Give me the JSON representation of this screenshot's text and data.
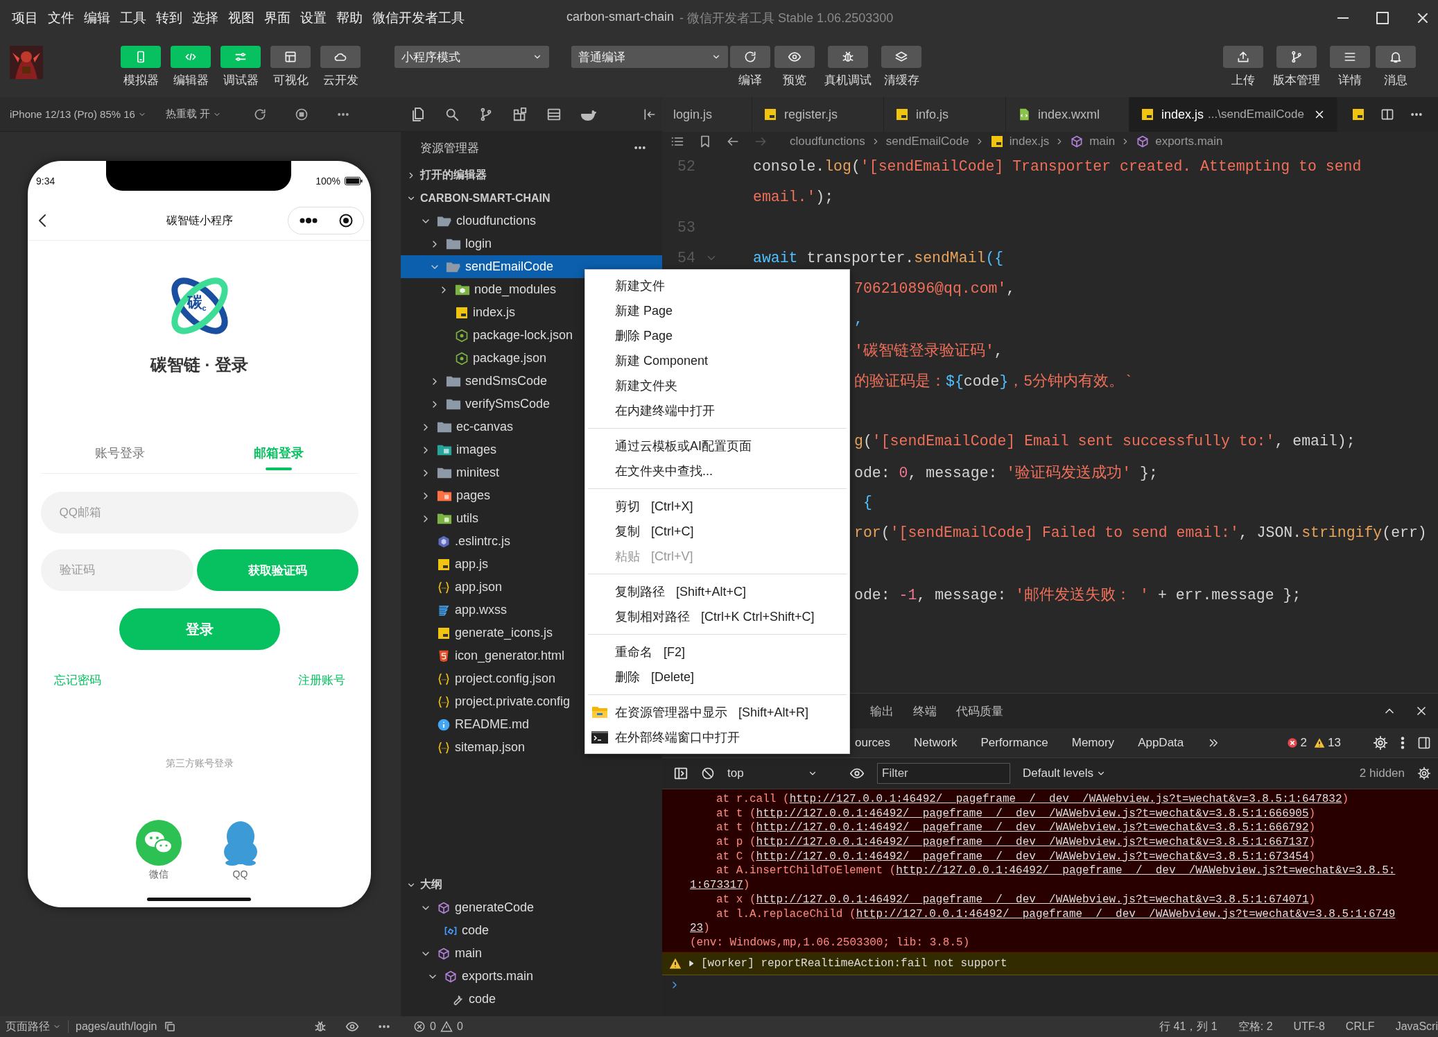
{
  "menubar": {
    "items": [
      "项目",
      "文件",
      "编辑",
      "工具",
      "转到",
      "选择",
      "视图",
      "界面",
      "设置",
      "帮助",
      "微信开发者工具"
    ],
    "title": "carbon-smart-chain",
    "subtitle": "- 微信开发者工具 Stable 1.06.2503300"
  },
  "toolbar": {
    "view_buttons": [
      {
        "label": "模拟器",
        "selected": true
      },
      {
        "label": "编辑器",
        "selected": true
      },
      {
        "label": "调试器",
        "selected": true
      },
      {
        "label": "可视化",
        "selected": false
      },
      {
        "label": "云开发",
        "selected": false
      }
    ],
    "mode_select": "小程序模式",
    "compile_select": "普通编译",
    "actions": [
      "编译",
      "预览",
      "真机调试",
      "清缓存"
    ],
    "right_actions": [
      "上传",
      "版本管理",
      "详情",
      "消息"
    ]
  },
  "simulator": {
    "device": "iPhone 12/13 (Pro) 85% 16",
    "hot_reload": "热重载 开",
    "phone": {
      "time": "9:34",
      "battery": "100%",
      "nav_title": "碳智链小程序",
      "logo_text": "碳$_{c}$",
      "app_title": "碳智链 · 登录",
      "tabs": [
        {
          "label": "账号登录",
          "selected": false
        },
        {
          "label": "邮箱登录",
          "selected": true
        }
      ],
      "email_placeholder": "QQ邮箱",
      "code_placeholder": "验证码",
      "get_code_button": "获取验证码",
      "login_button": "登录",
      "forgot_link": "忘记密码",
      "register_link": "注册账号",
      "third_party_label": "第三方账号登录",
      "social": [
        {
          "label": "微信",
          "kind": "wechat"
        },
        {
          "label": "QQ",
          "kind": "qq"
        }
      ]
    },
    "page_path_label": "页面路径",
    "page_path": "pages/auth/login"
  },
  "explorer": {
    "title": "资源管理器",
    "open_editors": "打开的编辑器",
    "project": "CARBON-SMART-CHAIN",
    "tree": [
      {
        "label": "cloudfunctions",
        "kind": "folder",
        "expanded": true,
        "selected": false,
        "children": [
          {
            "label": "login",
            "kind": "folder",
            "expanded": false,
            "selected": false
          },
          {
            "label": "sendEmailCode",
            "kind": "folder",
            "expanded": true,
            "selected": true,
            "children": [
              {
                "label": "node_modules",
                "kind": "node-folder",
                "expanded": false,
                "selected": false
              },
              {
                "label": "index.js",
                "kind": "js",
                "selected": false
              },
              {
                "label": "package-lock.json",
                "kind": "npm",
                "selected": false
              },
              {
                "label": "package.json",
                "kind": "npm",
                "selected": false
              }
            ]
          },
          {
            "label": "sendSmsCode",
            "kind": "folder",
            "expanded": false,
            "selected": false
          },
          {
            "label": "verifySmsCode",
            "kind": "folder",
            "expanded": false,
            "selected": false
          }
        ]
      },
      {
        "label": "ec-canvas",
        "kind": "folder",
        "expanded": false,
        "selected": false
      },
      {
        "label": "images",
        "kind": "image-folder",
        "expanded": false,
        "selected": false
      },
      {
        "label": "minitest",
        "kind": "folder",
        "expanded": false,
        "selected": false
      },
      {
        "label": "pages",
        "kind": "pages-folder",
        "expanded": false,
        "selected": false
      },
      {
        "label": "utils",
        "kind": "utils-folder",
        "expanded": false,
        "selected": false
      },
      {
        "label": ".eslintrc.js",
        "kind": "eslint",
        "selected": false
      },
      {
        "label": "app.js",
        "kind": "js",
        "selected": false
      },
      {
        "label": "app.json",
        "kind": "json",
        "selected": false
      },
      {
        "label": "app.wxss",
        "kind": "css",
        "selected": false
      },
      {
        "label": "generate_icons.js",
        "kind": "js",
        "selected": false
      },
      {
        "label": "icon_generator.html",
        "kind": "html",
        "selected": false
      },
      {
        "label": "project.config.json",
        "kind": "json",
        "selected": false
      },
      {
        "label": "project.private.config",
        "kind": "json",
        "selected": false
      },
      {
        "label": "README.md",
        "kind": "info",
        "selected": false
      },
      {
        "label": "sitemap.json",
        "kind": "json",
        "selected": false
      }
    ],
    "outline_title": "大纲",
    "outline": [
      {
        "label": "generateCode",
        "kind": "function",
        "expanded": true,
        "children": [
          {
            "label": "code",
            "kind": "variable"
          }
        ]
      },
      {
        "label": "main",
        "kind": "function",
        "expanded": true,
        "children": [
          {
            "label": "exports.main",
            "kind": "function",
            "expanded": true,
            "children": [
              {
                "label": "code",
                "kind": "property"
              }
            ]
          }
        ]
      }
    ],
    "problems": {
      "errors": "0",
      "warnings": "0"
    }
  },
  "editor": {
    "tabs": [
      {
        "label": "login.js",
        "kind": "none",
        "selected": false
      },
      {
        "label": "register.js",
        "kind": "js",
        "selected": false
      },
      {
        "label": "info.js",
        "kind": "js",
        "selected": false
      },
      {
        "label": "index.wxml",
        "kind": "wxml",
        "selected": false
      },
      {
        "label": "index.js",
        "description": "...\\sendEmailCode",
        "kind": "js",
        "selected": true
      }
    ],
    "breadcrumb": [
      {
        "label": "cloudfunctions",
        "kind": "folder"
      },
      {
        "label": "sendEmailCode",
        "kind": "folder"
      },
      {
        "label": "index.js",
        "kind": "js"
      },
      {
        "label": "main",
        "kind": "symbol"
      },
      {
        "label": "exports.main",
        "kind": "symbol"
      }
    ],
    "lines": [
      {
        "number": "52",
        "kind": "full",
        "segments": [
          {
            "t": "console.",
            "kind": "plain"
          },
          {
            "t": "log",
            "kind": "fn"
          },
          {
            "t": "(",
            "kind": "plain"
          },
          {
            "t": "'[sendEmailCode] Transporter created. Attempting to send",
            "kind": "str"
          }
        ]
      },
      {
        "kind": "full",
        "segments": [
          {
            "t": "email.'",
            "kind": "str"
          },
          {
            "t": ");",
            "kind": "plain"
          }
        ]
      },
      {
        "number": "53",
        "kind": "full"
      },
      {
        "number": "54",
        "kind": "full",
        "segments": [
          {
            "t": "await",
            "kind": "kw"
          },
          {
            "t": " transporter.",
            "kind": "plain"
          },
          {
            "t": "sendMail",
            "kind": "fn"
          },
          {
            "t": "({",
            "kind": "punc"
          }
        ]
      },
      {
        "kind": "after_menu",
        "segments": [
          {
            "t": "706210896@qq.com'",
            "kind": "str"
          },
          {
            "t": ",",
            "kind": "plain"
          }
        ]
      },
      {
        "kind": "after_menu",
        "segments": [
          {
            "t": ",",
            "kind": "punc"
          }
        ]
      },
      {
        "kind": "after_menu",
        "segments": [
          {
            "t": "'碳智链登录验证码'",
            "kind": "str"
          },
          {
            "t": ",",
            "kind": "plain"
          }
        ]
      },
      {
        "kind": "after_menu",
        "segments": [
          {
            "t": "的验证码是：",
            "kind": "str"
          },
          {
            "t": "${",
            "kind": "punc"
          },
          {
            "t": "code",
            "kind": "plain"
          },
          {
            "t": "}",
            "kind": "punc"
          },
          {
            "t": "，5分钟内有效。`",
            "kind": "str"
          }
        ]
      },
      {
        "kind": "after_menu"
      },
      {
        "kind": "after_menu",
        "segments": [
          {
            "t": "g",
            "kind": "fn"
          },
          {
            "t": "(",
            "kind": "plain"
          },
          {
            "t": "'[sendEmailCode] Email sent successfully to:'",
            "kind": "str"
          },
          {
            "t": ", email);",
            "kind": "plain"
          }
        ]
      },
      {
        "kind": "after_menu",
        "segments": [
          {
            "t": "ode: ",
            "kind": "plain"
          },
          {
            "t": "0",
            "kind": "num"
          },
          {
            "t": ", message: ",
            "kind": "plain"
          },
          {
            "t": "'验证码发送成功'",
            "kind": "str"
          },
          {
            "t": " };",
            "kind": "plain"
          }
        ]
      },
      {
        "kind": "after_menu",
        "segments": [
          {
            "t": " {",
            "kind": "punc"
          }
        ]
      },
      {
        "kind": "after_menu",
        "segments": [
          {
            "t": "ror",
            "kind": "fn"
          },
          {
            "t": "(",
            "kind": "plain"
          },
          {
            "t": "'[sendEmailCode] Failed to send email:'",
            "kind": "str"
          },
          {
            "t": ", JSON.",
            "kind": "plain"
          },
          {
            "t": "stringify",
            "kind": "fn"
          },
          {
            "t": "(err)",
            "kind": "plain"
          }
        ]
      },
      {
        "kind": "after_menu"
      },
      {
        "kind": "after_menu",
        "segments": [
          {
            "t": "ode: ",
            "kind": "plain"
          },
          {
            "t": "-1",
            "kind": "num"
          },
          {
            "t": ", message: ",
            "kind": "plain"
          },
          {
            "t": "'邮件发送失败： '",
            "kind": "str"
          },
          {
            "t": " + err.message };",
            "kind": "plain"
          }
        ]
      }
    ]
  },
  "context_menu": {
    "groups": [
      [
        {
          "label": "新建文件",
          "disabled": false
        },
        {
          "label": "新建 Page",
          "disabled": false
        },
        {
          "label": "删除 Page",
          "disabled": false
        },
        {
          "label": "新建 Component",
          "disabled": false
        },
        {
          "label": "新建文件夹",
          "disabled": false
        },
        {
          "label": "在内建终端中打开",
          "disabled": false
        }
      ],
      [
        {
          "label": "通过云模板或AI配置页面",
          "disabled": false
        },
        {
          "label": "在文件夹中查找...",
          "disabled": false
        }
      ],
      [
        {
          "label": "剪切",
          "shortcut": "[Ctrl+X]",
          "disabled": false
        },
        {
          "label": "复制",
          "shortcut": "[Ctrl+C]",
          "disabled": false
        },
        {
          "label": "粘贴",
          "shortcut": "[Ctrl+V]",
          "disabled": true
        }
      ],
      [
        {
          "label": "复制路径",
          "shortcut": "[Shift+Alt+C]",
          "disabled": false
        },
        {
          "label": "复制相对路径",
          "shortcut": "[Ctrl+K Ctrl+Shift+C]",
          "disabled": false
        }
      ],
      [
        {
          "label": "重命名",
          "shortcut": "[F2]",
          "disabled": false
        },
        {
          "label": "删除",
          "shortcut": "[Delete]",
          "disabled": false
        }
      ],
      [
        {
          "label": "在资源管理器中显示",
          "shortcut": "[Shift+Alt+R]",
          "disabled": false,
          "kind": "folder"
        },
        {
          "label": "在外部终端窗口中打开",
          "disabled": false,
          "kind": "terminal"
        }
      ]
    ]
  },
  "panel": {
    "tabs": [
      "输出",
      "终端",
      "代码质量"
    ],
    "devtools_tabs": [
      "ources",
      "Network",
      "Performance",
      "Memory",
      "AppData"
    ],
    "error_count": "2",
    "warning_count": "13",
    "context": "top",
    "filter_placeholder": "Filter",
    "levels": "Default levels",
    "hidden": "2 hidden",
    "console": [
      {
        "kind": "frame",
        "text": "at r.call (",
        "link": "http://127.0.0.1:46492/__pageframe__/__dev__/WAWebview.js?t=wechat&v=3.8.5:1:647832",
        "suffix": ")"
      },
      {
        "kind": "frame",
        "text": "at t (",
        "link": "http://127.0.0.1:46492/__pageframe__/__dev__/WAWebview.js?t=wechat&v=3.8.5:1:666905",
        "suffix": ")"
      },
      {
        "kind": "frame",
        "text": "at t (",
        "link": "http://127.0.0.1:46492/__pageframe__/__dev__/WAWebview.js?t=wechat&v=3.8.5:1:666792",
        "suffix": ")"
      },
      {
        "kind": "frame",
        "text": "at p (",
        "link": "http://127.0.0.1:46492/__pageframe__/__dev__/WAWebview.js?t=wechat&v=3.8.5:1:667137",
        "suffix": ")"
      },
      {
        "kind": "frame",
        "text": "at C (",
        "link": "http://127.0.0.1:46492/__pageframe__/__dev__/WAWebview.js?t=wechat&v=3.8.5:1:673454",
        "suffix": ")"
      },
      {
        "kind": "frame",
        "text": "at A.insertChildToElement (",
        "link": "http://127.0.0.1:46492/__pageframe__/__dev__/WAWebview.js?t=wechat&v=3.8.5:"
      },
      {
        "kind": "wrap",
        "link": "1:673317",
        "suffix": ")"
      },
      {
        "kind": "frame",
        "text": "at x (",
        "link": "http://127.0.0.1:46492/__pageframe__/__dev__/WAWebview.js?t=wechat&v=3.8.5:1:674071",
        "suffix": ")"
      },
      {
        "kind": "frame",
        "text": "at l.A.replaceChild (",
        "link": "http://127.0.0.1:46492/__pageframe__/__dev__/WAWebview.js?t=wechat&v=3.8.5:1:6749"
      },
      {
        "kind": "wrap",
        "link": "23",
        "suffix": ")"
      },
      {
        "kind": "env",
        "text": "(env: Windows,mp,1.06.2503300; lib: 3.8.5)"
      }
    ],
    "warning": "[worker] reportRealtimeAction:fail not support"
  },
  "status_bar": {
    "position": "行 41，列 1",
    "spaces": "空格: 2",
    "encoding": "UTF-8",
    "eol": "CRLF",
    "language": "JavaScri"
  }
}
